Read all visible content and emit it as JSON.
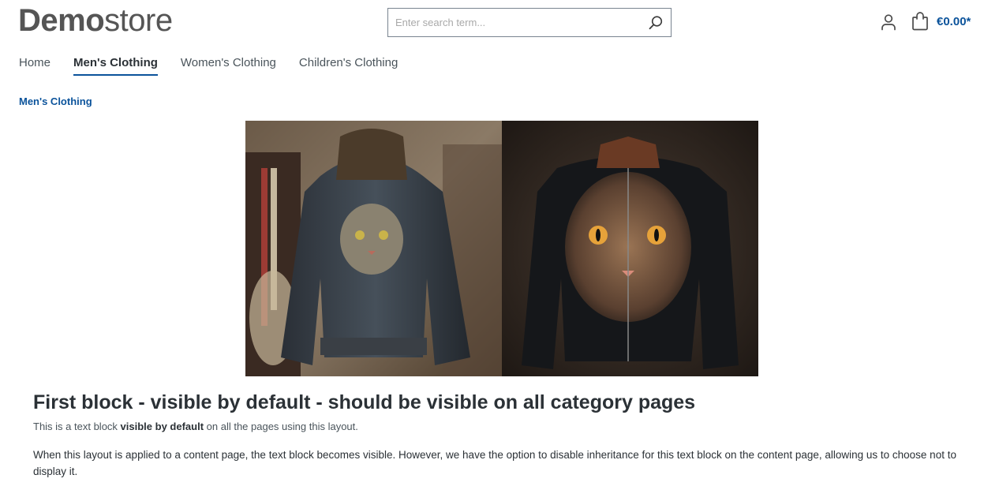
{
  "header": {
    "logo_strong": "Demo",
    "logo_light": "store",
    "search_placeholder": "Enter search term...",
    "search_value": "",
    "cart_total": "€0.00*",
    "icons": {
      "search": "search-icon",
      "account": "user-icon",
      "cart": "shopping-bag-icon"
    }
  },
  "nav": {
    "items": [
      {
        "label": "Home",
        "active": false
      },
      {
        "label": "Men's Clothing",
        "active": true
      },
      {
        "label": "Women's Clothing",
        "active": false
      },
      {
        "label": "Children's Clothing",
        "active": false
      }
    ]
  },
  "breadcrumb": {
    "current": "Men's Clothing"
  },
  "banner": {
    "images": [
      {
        "alt": "Leather jacket with painted tabby cat on hanger"
      },
      {
        "alt": "Black leather jacket with painted cat face"
      }
    ]
  },
  "block": {
    "heading": "First block - visible by default - should be visible on all category pages",
    "intro_prefix": "This is a text block ",
    "intro_bold": "visible by default",
    "intro_suffix": " on all the pages using this layout.",
    "body": "When this layout is applied to a content page, the text block becomes visible. However, we have the option to disable inheritance for this text block on the content page, allowing us to choose not to display it."
  },
  "colors": {
    "accent": "#0b539b",
    "text": "#2b3136",
    "logo": "#555555"
  }
}
